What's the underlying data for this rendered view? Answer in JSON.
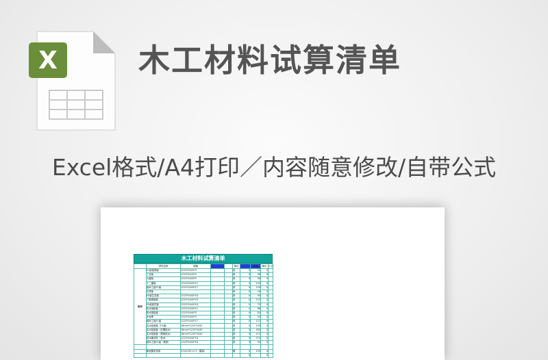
{
  "header": {
    "title": "木工材料试算清单",
    "subtitle": "Excel格式/A4打印／内容随意修改/自带公式"
  },
  "icon": {
    "name": "excel-file-icon",
    "letter": "X",
    "accent": "#6b8e3a"
  },
  "sheet": {
    "title": "木工材料试算清单",
    "headers": [
      "材料名称",
      "规格",
      "",
      "",
      "单位",
      "",
      "数量",
      "单价",
      "小计"
    ],
    "category": "板材",
    "rows": [
      {
        "name": "E1级阻燃板",
        "spec": "1220*2440*3",
        "unit": "张",
        "n": "0",
        "q": "10",
        "t": "0"
      },
      {
        "name": "三合板",
        "spec": "1220*2440*5",
        "unit": "张",
        "n": "0",
        "q": "36",
        "t": "0"
      },
      {
        "name": "九厘板",
        "spec": "1220*2440*9",
        "unit": "张",
        "n": "0",
        "q": "56",
        "t": "0"
      },
      {
        "name": "十二厘板",
        "spec": "1220*2440*12",
        "unit": "张",
        "n": "0",
        "q": "105",
        "t": "0"
      },
      {
        "name": "细木工板E1级",
        "spec": "1220*2440*17",
        "unit": "张",
        "n": "0",
        "q": "118",
        "t": "0"
      },
      {
        "name": "石膏板",
        "spec": "",
        "unit": "张",
        "n": "0",
        "q": "18",
        "t": "0"
      },
      {
        "name": "E0级生态板",
        "spec": "1220*2440*18",
        "unit": "张",
        "n": "0",
        "q": "95",
        "t": "0"
      },
      {
        "name": "三聚氰胺板",
        "spec": "1220*2440*18",
        "unit": "张",
        "n": "0",
        "q": "115",
        "t": "0"
      },
      {
        "name": "E0级刨花板",
        "spec": "1220*2440*18",
        "unit": "张",
        "n": "0",
        "q": "70",
        "t": "0"
      },
      {
        "name": "松木指接板",
        "spec": "1220*2440*12",
        "unit": "张",
        "n": "0",
        "q": "68",
        "t": "0"
      },
      {
        "name": "松木指接板",
        "spec": "1220*2440*3",
        "unit": "张",
        "n": "0",
        "q": "83",
        "t": "0"
      },
      {
        "name": "木龙骨",
        "spec": "1220*2440*3",
        "unit": "张",
        "n": "0",
        "q": "45",
        "t": "0"
      },
      {
        "name": "细木工板E1级",
        "spec": "1220*2440*17",
        "unit": "张",
        "n": "0",
        "q": "112",
        "t": "0"
      },
      {
        "name": "实木贴面板（E1级）",
        "spec": "18mm*1220*2440",
        "unit": "张",
        "n": "0",
        "q": "143",
        "t": "0"
      },
      {
        "name": "实木贴面板（红樱桃木）",
        "spec": "18mm*1220*2440",
        "unit": "张",
        "n": "0",
        "q": "162",
        "t": "0"
      },
      {
        "name": "实木贴面板（黑胡桃木）",
        "spec": "18mm*1220*2440",
        "unit": "张",
        "n": "0",
        "q": "215",
        "t": "0"
      },
      {
        "name": "松木集成材（松木）",
        "spec": "1220*2440*18",
        "unit": "张",
        "n": "0",
        "q": "110",
        "t": "0"
      },
      {
        "name": "细木工板E1级（橡胶）",
        "spec": "1220*2440*18",
        "unit": "张",
        "n": "0",
        "q": "95",
        "t": "0"
      }
    ],
    "extra_rows": [
      {
        "name": "聚氨酯发泡胶",
        "spec": "3.5A/150=0.5（套装）",
        "unit": "套",
        "n": "0",
        "q": "109",
        "t": "0"
      },
      {
        "name": "",
        "spec": "",
        "unit": "",
        "n": "0",
        "q": "",
        "t": "0"
      }
    ]
  }
}
